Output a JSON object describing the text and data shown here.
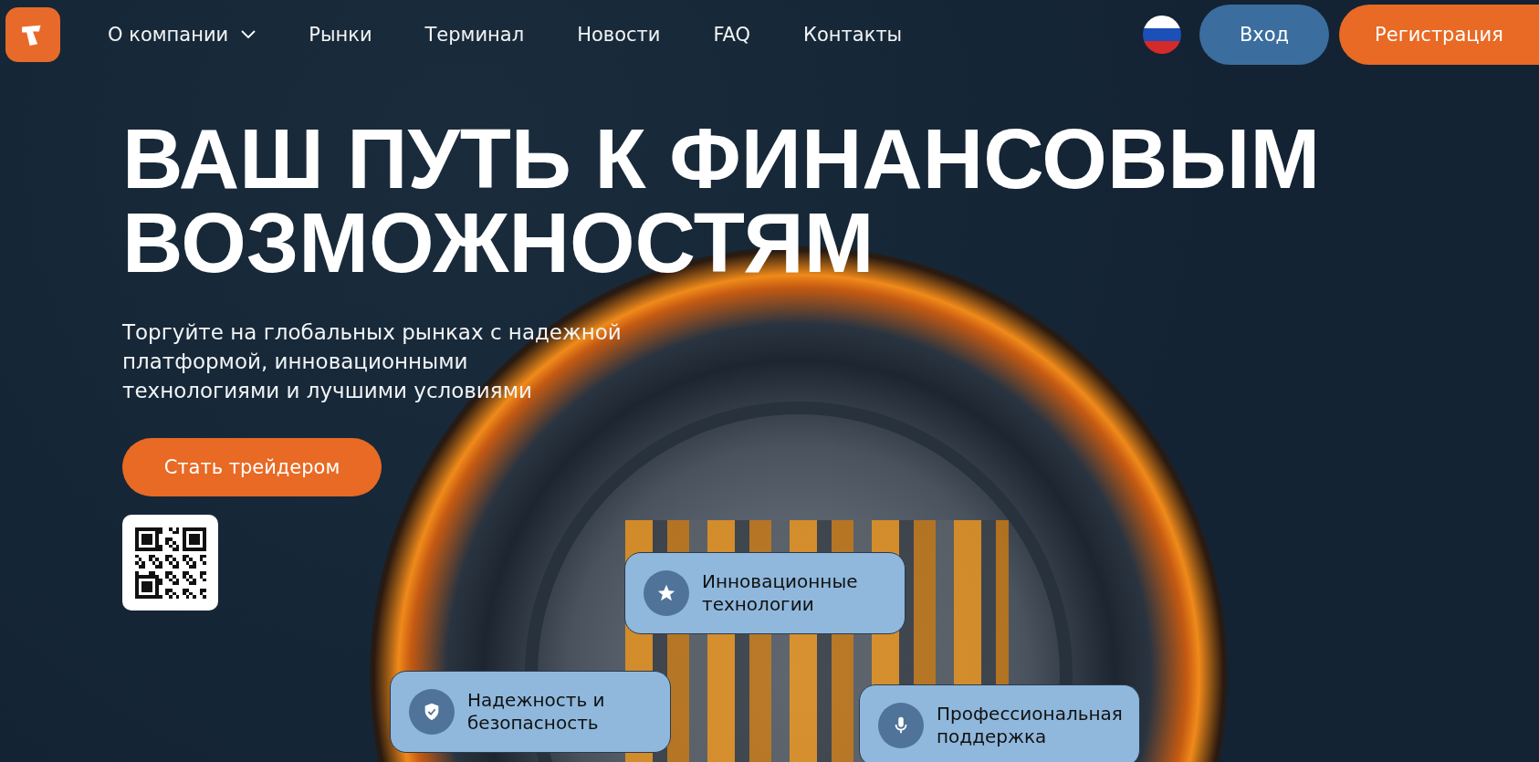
{
  "nav": {
    "items": [
      {
        "label": "О компании",
        "has_dropdown": true
      },
      {
        "label": "Рынки",
        "has_dropdown": false
      },
      {
        "label": "Терминал",
        "has_dropdown": false
      },
      {
        "label": "Новости",
        "has_dropdown": false
      },
      {
        "label": "FAQ",
        "has_dropdown": false
      },
      {
        "label": "Контакты",
        "has_dropdown": false
      }
    ],
    "login": "Вход",
    "register": "Регистрация"
  },
  "hero": {
    "title_lines": [
      "ВАШ ПУТЬ К ФИНАНСОВЫМ",
      "ВОЗМОЖНОСТЯМ"
    ],
    "subtitle_lines": [
      "Торгуйте на глобальных рынках с надежной",
      "платформой, инновационными",
      "технологиями и лучшими условиями"
    ],
    "cta": "Стать трейдером"
  },
  "features": [
    {
      "kind": "star",
      "lines": [
        "Инновационные",
        "технологии"
      ]
    },
    {
      "kind": "shield",
      "lines": [
        "Надежность и",
        "безопасность"
      ]
    },
    {
      "kind": "mic",
      "lines": [
        "Профессиональная",
        "поддержка"
      ]
    }
  ]
}
